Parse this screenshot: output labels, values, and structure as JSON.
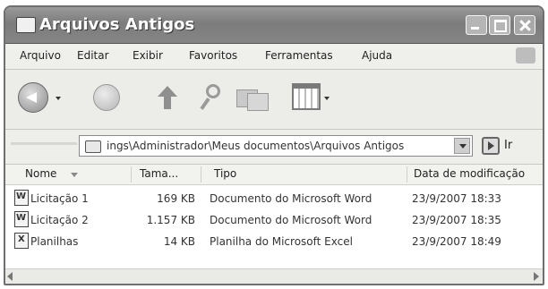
{
  "window": {
    "title": "Arquivos Antigos"
  },
  "menu": [
    "Arquivo",
    "Editar",
    "Exibir",
    "Favoritos",
    "Ferramentas",
    "Ajuda"
  ],
  "toolbar": {
    "icons": [
      "back-icon",
      "forward-icon",
      "up-folder-icon",
      "search-icon",
      "folders-icon",
      "views-icon"
    ]
  },
  "address": {
    "path": "ings\\Administrador\\Meus documentos\\Arquivos Antigos",
    "go_label": "Ir"
  },
  "columns": [
    "Nome",
    "Tama...",
    "Tipo",
    "Data de modificação"
  ],
  "files": [
    {
      "name": "Licitação 1",
      "size": "169 KB",
      "type": "Documento do Microsoft Word",
      "modified": "23/9/2007 18:33",
      "icon": "word-doc-icon"
    },
    {
      "name": "Licitação 2",
      "size": "1.157 KB",
      "type": "Documento do Microsoft Word",
      "modified": "23/9/2007 18:35",
      "icon": "word-doc-icon"
    },
    {
      "name": "Planilhas",
      "size": "14 KB",
      "type": "Planilha do Microsoft Excel",
      "modified": "23/9/2007 18:49",
      "icon": "excel-sheet-icon"
    }
  ]
}
